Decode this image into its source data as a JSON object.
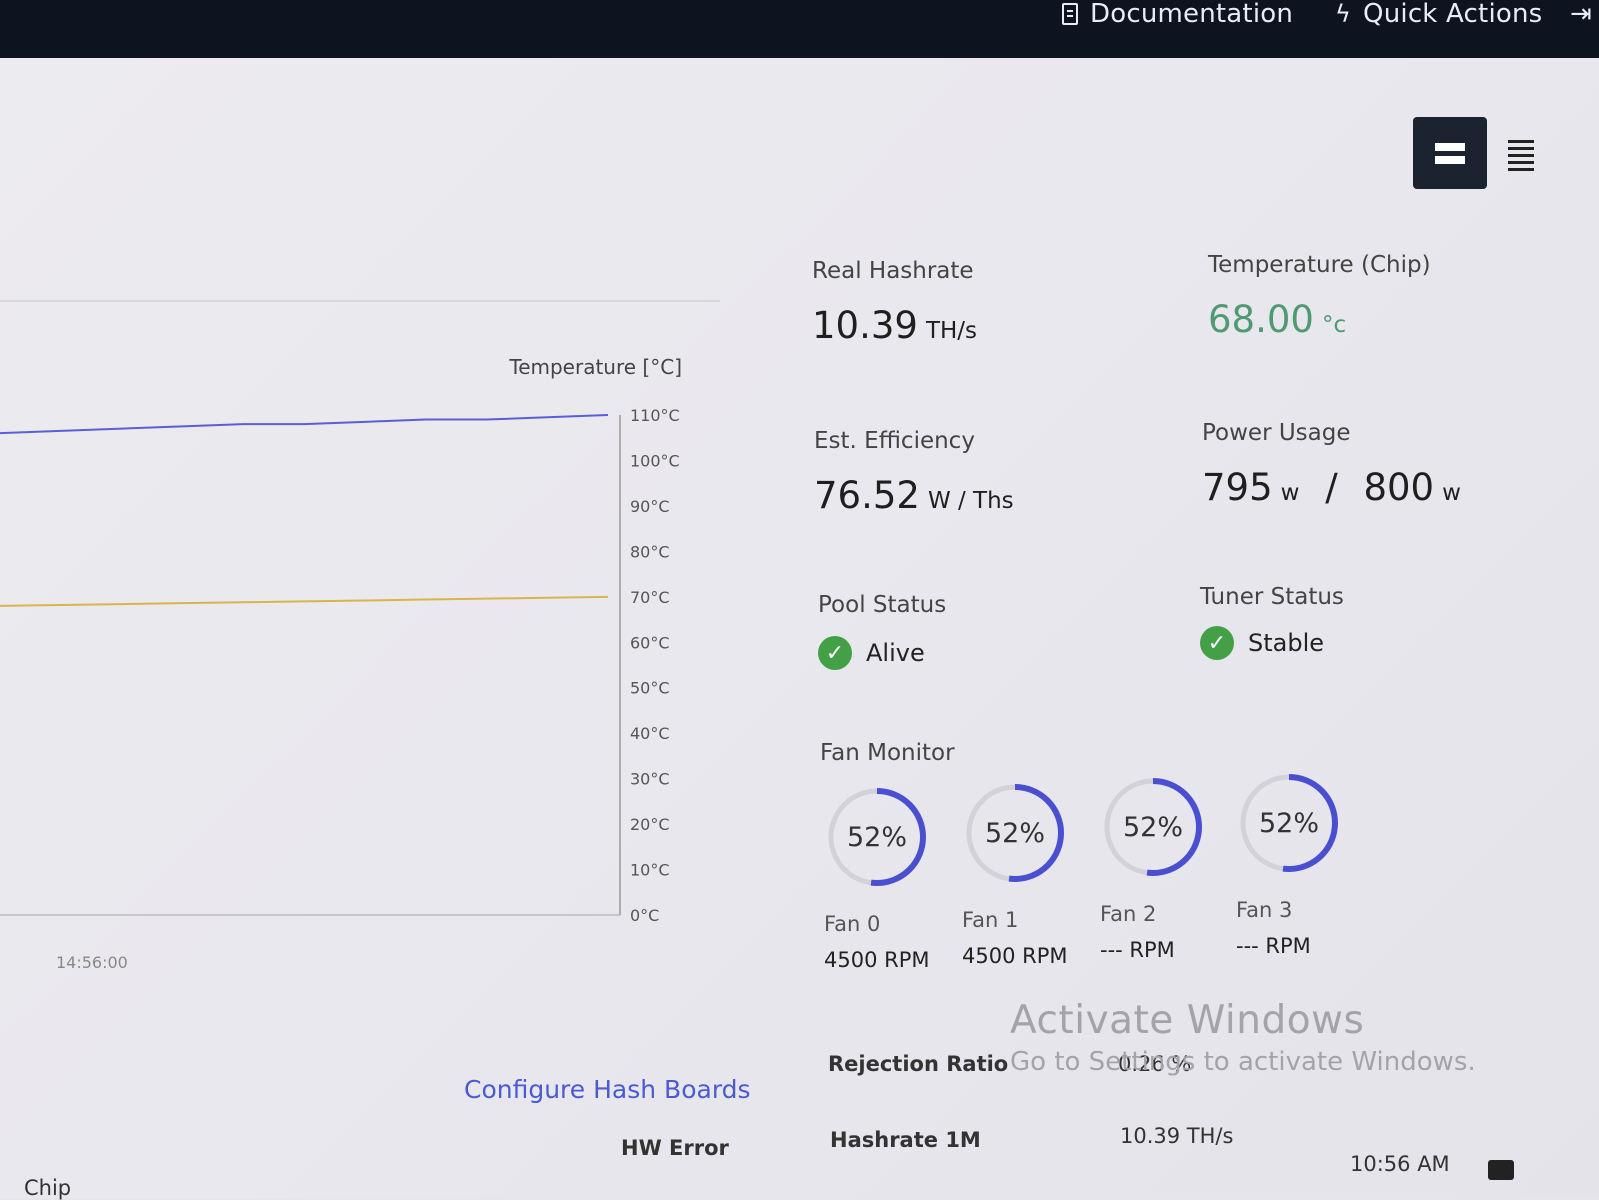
{
  "topbar": {
    "documentation": "Documentation",
    "quick_actions": "Quick Actions"
  },
  "chart_data": {
    "type": "line",
    "title": "",
    "ylabel": "Temperature [°C]",
    "ylim": [
      0,
      110
    ],
    "y_ticks": [
      "110°C",
      "100°C",
      "90°C",
      "80°C",
      "70°C",
      "60°C",
      "50°C",
      "40°C",
      "30°C",
      "20°C",
      "10°C",
      "0°C"
    ],
    "x_ticks": [
      "14:56:00"
    ],
    "series": [
      {
        "color": "#5b5fd6",
        "x": [
          0,
          1,
          2,
          3,
          4,
          5,
          6,
          7,
          8,
          9,
          10
        ],
        "values": [
          106,
          106.5,
          107,
          107.5,
          108,
          108,
          108.5,
          109,
          109,
          109.5,
          110
        ]
      },
      {
        "color": "#d8b54a",
        "x": [
          0,
          1,
          2,
          3,
          4,
          5,
          6,
          7,
          8,
          9,
          10
        ],
        "values": [
          68,
          68.2,
          68.4,
          68.6,
          68.8,
          69,
          69.2,
          69.4,
          69.6,
          69.8,
          70
        ]
      }
    ]
  },
  "stats": {
    "real_hashrate": {
      "label": "Real Hashrate",
      "value": "10.39",
      "unit": "TH/s"
    },
    "temperature_chip": {
      "label": "Temperature (Chip)",
      "value": "68.00",
      "unit": "°c"
    },
    "efficiency": {
      "label": "Est. Efficiency",
      "value": "76.52",
      "unit": "W / Ths"
    },
    "power_usage": {
      "label": "Power Usage",
      "value": "795",
      "unit": "w",
      "separator": "/",
      "limit": "800",
      "limit_unit": "w"
    },
    "pool_status": {
      "label": "Pool Status",
      "value": "Alive"
    },
    "tuner_status": {
      "label": "Tuner Status",
      "value": "Stable"
    }
  },
  "fan_monitor": {
    "title": "Fan Monitor",
    "fans": [
      {
        "name": "Fan 0",
        "percent": "52%",
        "fraction": 0.52,
        "rpm": "4500 RPM"
      },
      {
        "name": "Fan 1",
        "percent": "52%",
        "fraction": 0.52,
        "rpm": "4500 RPM"
      },
      {
        "name": "Fan 2",
        "percent": "52%",
        "fraction": 0.52,
        "rpm": "--- RPM"
      },
      {
        "name": "Fan 3",
        "percent": "52%",
        "fraction": 0.52,
        "rpm": "--- RPM"
      }
    ]
  },
  "bottom": {
    "configure_link": "Configure Hash Boards",
    "hw_error": "HW Error",
    "rejection_label": "Rejection Ratio",
    "rejection_value": "0.26 %",
    "hashrate_1m_label": "Hashrate 1M",
    "hashrate_1m_value": "10.39 TH/s",
    "chip_label": "Chip"
  },
  "watermark": {
    "line1": "Activate Windows",
    "line2": "Go to Settings to activate Windows."
  },
  "taskbar": {
    "time": "10:56 AM"
  },
  "colors": {
    "accent": "#4a4fd0",
    "status_green": "#43a047",
    "topbar_bg": "#0d1420"
  }
}
